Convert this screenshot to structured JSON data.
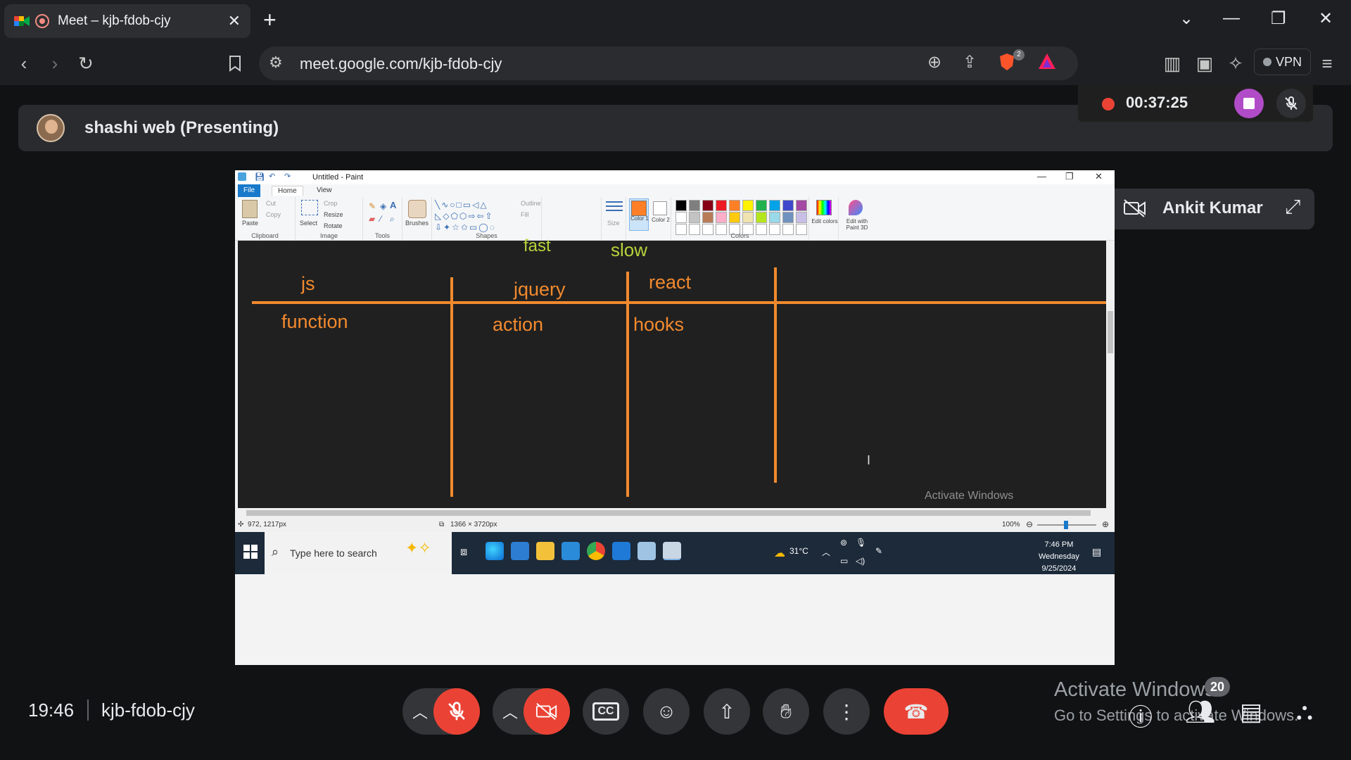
{
  "browser": {
    "tab_title": "Meet – kjb-fdob-cjy",
    "tab_close": "✕",
    "new_tab": "+",
    "url": "meet.google.com/kjb-fdob-cjy",
    "brave_badge": "2",
    "vpn_label": "VPN"
  },
  "meet": {
    "presenter": "shashi web (Presenting)",
    "recording_time": "00:37:25",
    "participant_name": "Ankit Kumar",
    "time": "19:46",
    "meeting_code": "kjb-fdob-cjy",
    "participants_badge": "20",
    "activate_title": "Activate Windows",
    "activate_sub": "Go to Settings to activate Windows."
  },
  "paint": {
    "window_title": "Untitled - Paint",
    "tabs": {
      "file": "File",
      "home": "Home",
      "view": "View"
    },
    "clipboard": {
      "paste": "Paste",
      "cut": "Cut",
      "copy": "Copy",
      "label": "Clipboard"
    },
    "image": {
      "select": "Select",
      "crop": "Crop",
      "resize": "Resize",
      "rotate": "Rotate",
      "label": "Image"
    },
    "tools": {
      "label": "Tools"
    },
    "brushes": "Brushes",
    "shapes": {
      "label": "Shapes",
      "outline": "Outline",
      "fill": "Fill"
    },
    "size": "Size",
    "color1": "Color 1",
    "color2": "Color 2",
    "colors_label": "Colors",
    "edit_colors": "Edit colors",
    "edit_paint3d": "Edit with Paint 3D",
    "palette": [
      "#000000",
      "#7f7f7f",
      "#880015",
      "#ed1c24",
      "#ff7f27",
      "#fff200",
      "#22b14c",
      "#00a2e8",
      "#3f48cc",
      "#a349a4",
      "#ffffff",
      "#c3c3c3",
      "#b97a57",
      "#ffaec9",
      "#ffc90e",
      "#efe4b0",
      "#b5e61d",
      "#99d9ea",
      "#7092be",
      "#c8bfe7"
    ],
    "canvas_words": {
      "fast": "fast",
      "slow": "slow",
      "js": "js",
      "jquery": "jquery",
      "react": "react",
      "function": "function",
      "action": "action",
      "hooks": "hooks"
    },
    "canvas_activate": "Activate Windows",
    "status": {
      "position": "972, 1217px",
      "dimensions": "1366 × 3720px",
      "zoom": "100%"
    }
  },
  "windows_taskbar": {
    "search_placeholder": "Type here to search",
    "weather": "31°C",
    "clock_time": "7:46 PM",
    "clock_day": "Wednesday",
    "clock_date": "9/25/2024"
  },
  "colors": {
    "accent_orange": "#f28a2e",
    "green_text": "#b7d23a",
    "end_call_red": "#ea4335",
    "recording_purple": "#b14cc8"
  }
}
